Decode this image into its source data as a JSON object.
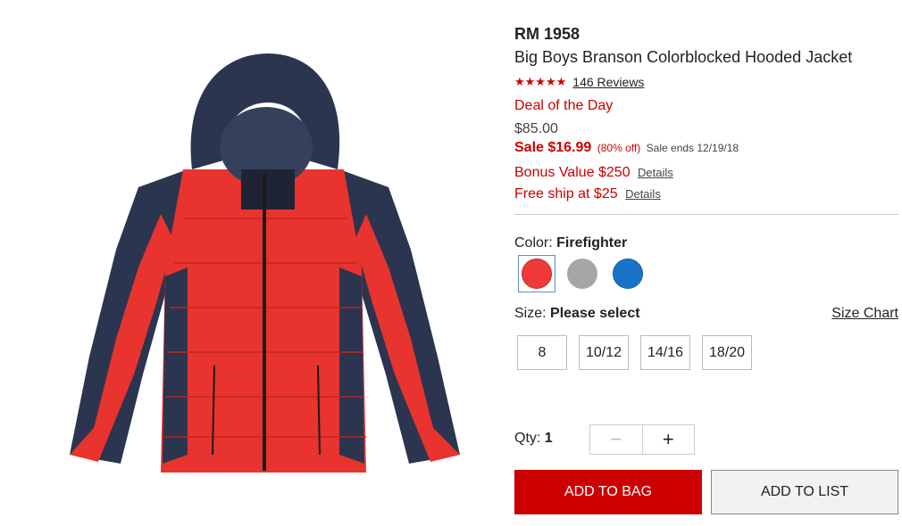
{
  "product": {
    "brand": "RM 1958",
    "title": "Big Boys Branson Colorblocked Hooded Jacket",
    "stars": "★★★★★",
    "rating": 5,
    "reviews": "146 Reviews"
  },
  "pricing": {
    "deal": "Deal of the Day",
    "original": "$85.00",
    "sale_label": "Sale $16.99",
    "sale_pct": "(80% off)",
    "sale_ends": "Sale ends 12/19/18"
  },
  "promos": [
    {
      "text": "Bonus Value $250",
      "details": "Details"
    },
    {
      "text": "Free ship at $25",
      "details": "Details"
    }
  ],
  "color": {
    "label": "Color:",
    "selected": "Firefighter",
    "swatches": [
      {
        "name": "Firefighter",
        "hex": "#f0393b",
        "selected": true
      },
      {
        "name": "Gray",
        "hex": "#a6a6a6",
        "selected": false
      },
      {
        "name": "Blue",
        "hex": "#1a73c9",
        "selected": false
      }
    ]
  },
  "size": {
    "label": "Size:",
    "value": "Please select",
    "chart_link": "Size Chart",
    "options": [
      "8",
      "10/12",
      "14/16",
      "18/20"
    ]
  },
  "qty": {
    "label": "Qty:",
    "value": "1",
    "minus": "−",
    "plus": "+"
  },
  "actions": {
    "add_to_bag": "ADD TO BAG",
    "add_to_list": "ADD TO LIST"
  },
  "colors": {
    "accent": "#cc0000",
    "jacket_red": "#e8332e",
    "jacket_navy": "#2b3550"
  },
  "image": {
    "icon": "hooded-jacket-image"
  }
}
